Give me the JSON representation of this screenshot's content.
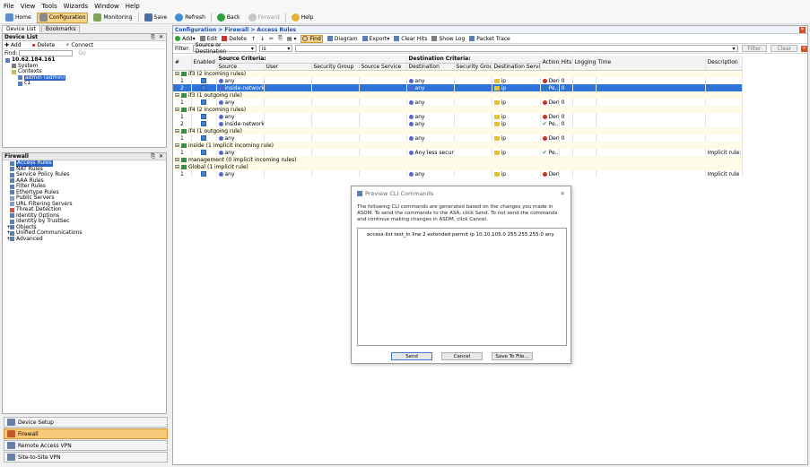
{
  "menu": [
    "File",
    "View",
    "Tools",
    "Wizards",
    "Window",
    "Help"
  ],
  "toolbar": {
    "home": "Home",
    "configuration": "Configuration",
    "monitoring": "Monitoring",
    "save": "Save",
    "refresh": "Refresh",
    "back": "Back",
    "forward": "Forward",
    "help": "Help"
  },
  "left": {
    "tabs": [
      "Device List",
      "Bookmarks"
    ],
    "device_list": {
      "title": "Device List",
      "add": "Add",
      "delete": "Delete",
      "connect": "Connect",
      "find_label": "Find:",
      "go": "Go",
      "tree": [
        "10.62.184.161",
        "System",
        "Contexts",
        "admin (admin)",
        "c1"
      ]
    },
    "firewall": {
      "title": "Firewall",
      "items": [
        "Access Rules",
        "NAT Rules",
        "Service Policy Rules",
        "AAA Rules",
        "Filter Rules",
        "Ethertype Rules",
        "Public Servers",
        "URL Filtering Servers",
        "Threat Detection",
        "Identity Options",
        "Identity by TrustSec",
        "Objects",
        "Unified Communications",
        "Advanced"
      ]
    },
    "nav": [
      "Device Setup",
      "Firewall",
      "Remote Access VPN",
      "Site-to-Site VPN"
    ]
  },
  "right": {
    "breadcrumb": "Configuration > Firewall > Access Rules",
    "toolbar": [
      "Add",
      "Edit",
      "Delete",
      "Find",
      "Diagram",
      "Export",
      "Clear Hits",
      "Show Log",
      "Packet Trace"
    ],
    "filter": {
      "label": "Filter:",
      "field": "Source or Destination",
      "op": "is",
      "filter_btn": "Filter",
      "clear_btn": "Clear"
    },
    "headers": {
      "num": "#",
      "enabled": "Enabled",
      "source_criteria": "Source Criteria:",
      "destination_criteria": "Destination Criteria:",
      "source": "Source",
      "user": "User",
      "sgroup": "Security Group",
      "sservice": "Source Service",
      "destination": "Destination",
      "dgroup": "Security Group",
      "dservice": "Destination Service",
      "action": "Action",
      "hits": "Hits",
      "logging": "Logging",
      "time": "Time",
      "description": "Description"
    },
    "rows": [
      {
        "type": "group",
        "label": "if3 (2 incoming rules)"
      },
      {
        "type": "rule",
        "num": "1",
        "source": "any",
        "dest": "any",
        "service": "ip",
        "action": "Deny",
        "hits": "0",
        "desc": ""
      },
      {
        "type": "rule",
        "sel": true,
        "num": "2",
        "source": "inside-network/24",
        "dest": "any",
        "service": "ip",
        "action": "Pe...",
        "hits": "0",
        "desc": ""
      },
      {
        "type": "group",
        "label": "if3 (1 outgoing rule)"
      },
      {
        "type": "rule",
        "num": "1",
        "source": "any",
        "dest": "any",
        "service": "ip",
        "action": "Deny",
        "hits": "0",
        "desc": ""
      },
      {
        "type": "group",
        "label": "if4 (2 incoming rules)"
      },
      {
        "type": "rule",
        "num": "1",
        "source": "any",
        "dest": "any",
        "service": "ip",
        "action": "Deny",
        "hits": "0",
        "desc": ""
      },
      {
        "type": "rule",
        "num": "2",
        "source": "inside-network/24",
        "dest": "any",
        "service": "ip",
        "action": "Pe...",
        "hits": "0",
        "desc": ""
      },
      {
        "type": "group",
        "label": "if4 (1 outgoing rule)"
      },
      {
        "type": "rule",
        "num": "1",
        "source": "any",
        "dest": "any",
        "service": "ip",
        "action": "Deny",
        "hits": "0",
        "desc": ""
      },
      {
        "type": "group",
        "label": "inside (1 implicit incoming rule)"
      },
      {
        "type": "rule",
        "num": "1",
        "source": "any",
        "dest": "Any less secure ...",
        "service": "ip",
        "action": "Pe...",
        "hits": "",
        "desc": "Implicit rule:..."
      },
      {
        "type": "group",
        "label": "management (0 implicit incoming rules)"
      },
      {
        "type": "group",
        "label": "Global (1 implicit rule)"
      },
      {
        "type": "rule",
        "num": "1",
        "source": "any",
        "dest": "any",
        "service": "ip",
        "action": "Deny",
        "hits": "",
        "desc": "Implicit rule"
      }
    ]
  },
  "dialog": {
    "title": "Preview CLI Commands",
    "text": "The following CLI commands are generated based on the changes you made in ASDM. To send the commands to the ASA, click Send. To not send the commands and continue making changes in ASDM, click Cancel.",
    "command": "access-list test_in line 2 extended permit ip 10.10.105.0 255.255.255.0 any",
    "send": "Send",
    "cancel": "Cancel",
    "save": "Save To File..."
  }
}
